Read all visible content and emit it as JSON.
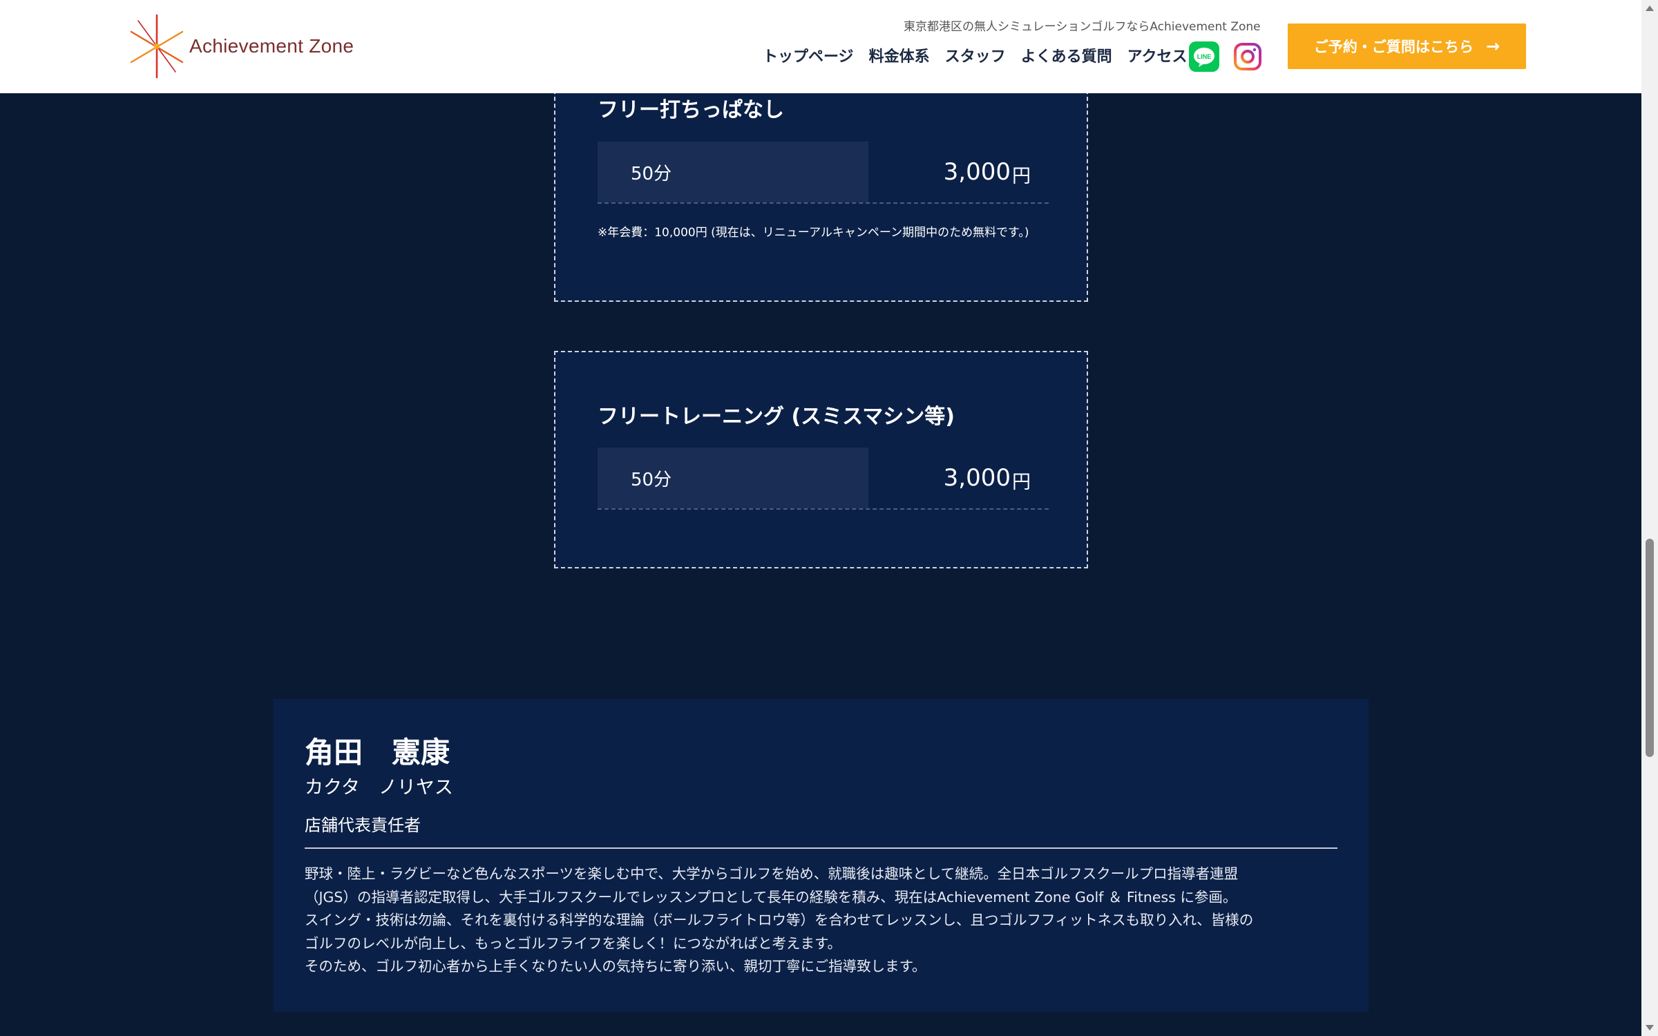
{
  "header": {
    "logo_text": "Achievement Zone",
    "tagline": "東京都港区の無人シミュレーションゴルフならAchievement Zone",
    "nav": [
      "トップページ",
      "料金体系",
      "スタッフ",
      "よくある質問",
      "アクセス"
    ],
    "cta_label": "ご予約・ご質問はこちら",
    "cta_arrow": "→",
    "line_label": "LINE",
    "accent": "#f9ab1c"
  },
  "pricing": [
    {
      "title": "フリー打ちっぱなし",
      "duration": "50分",
      "price": "3,000",
      "unit": "円",
      "note": "※年会費：10,000円 (現在は、リニューアルキャンペーン期間中のため無料です。)"
    },
    {
      "title": "フリートレーニング (スミスマシン等)",
      "duration": "50分",
      "price": "3,000",
      "unit": "円"
    }
  ],
  "staff": {
    "name": "角田　憲康",
    "kana": "カクタ　ノリヤス",
    "role": "店舗代表責任者",
    "bio": [
      "野球・陸上・ラグビーなど色んなスポーツを楽しむ中で、大学からゴルフを始め、就職後は趣味として継続。全日本ゴルフスクールプロ指導者連盟",
      "（JGS）の指導者認定取得し、大手ゴルフスクールでレッスンプロとして長年の経験を積み、現在はAchievement Zone Golf ＆ Fitness に参画。",
      "スイング・技術は勿論、それを裏付ける科学的な理論（ボールフライトロウ等）を合わせてレッスンし、且つゴルフフィットネスも取り入れ、皆様の",
      "ゴルフのレベルが向上し、もっとゴルフライフを楽しく！につながればと考えます。",
      "そのため、ゴルフ初心者から上手くなりたい人の気持ちに寄り添い、親切丁寧にご指導致します。"
    ]
  }
}
